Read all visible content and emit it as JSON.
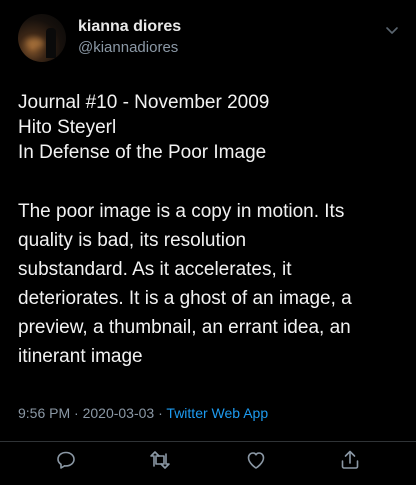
{
  "user": {
    "display_name": "kianna diores",
    "handle": "@kiannadiores"
  },
  "tweet": {
    "header_lines": [
      "Journal #10 - November 2009",
      "Hito Steyerl",
      "In Defense of the Poor Image"
    ],
    "quote_lines": [
      "The poor image is a copy in motion. Its",
      "quality is bad, its resolution",
      "substandard. As it accelerates, it",
      "deteriorates. It is a ghost of an image, a",
      "preview, a thumbnail, an errant idea, an",
      "itinerant image"
    ],
    "time": "9:56 PM",
    "separator": "·",
    "date": "2020-03-03",
    "source": "Twitter Web App"
  },
  "icons": {
    "more": "chevron-down-icon",
    "reply": "reply-icon",
    "retweet": "retweet-icon",
    "like": "heart-icon",
    "share": "share-icon"
  },
  "colors": {
    "background": "#000000",
    "text": "#f2f2f2",
    "secondary": "#8b98a5",
    "accent": "#1d9bf0"
  }
}
